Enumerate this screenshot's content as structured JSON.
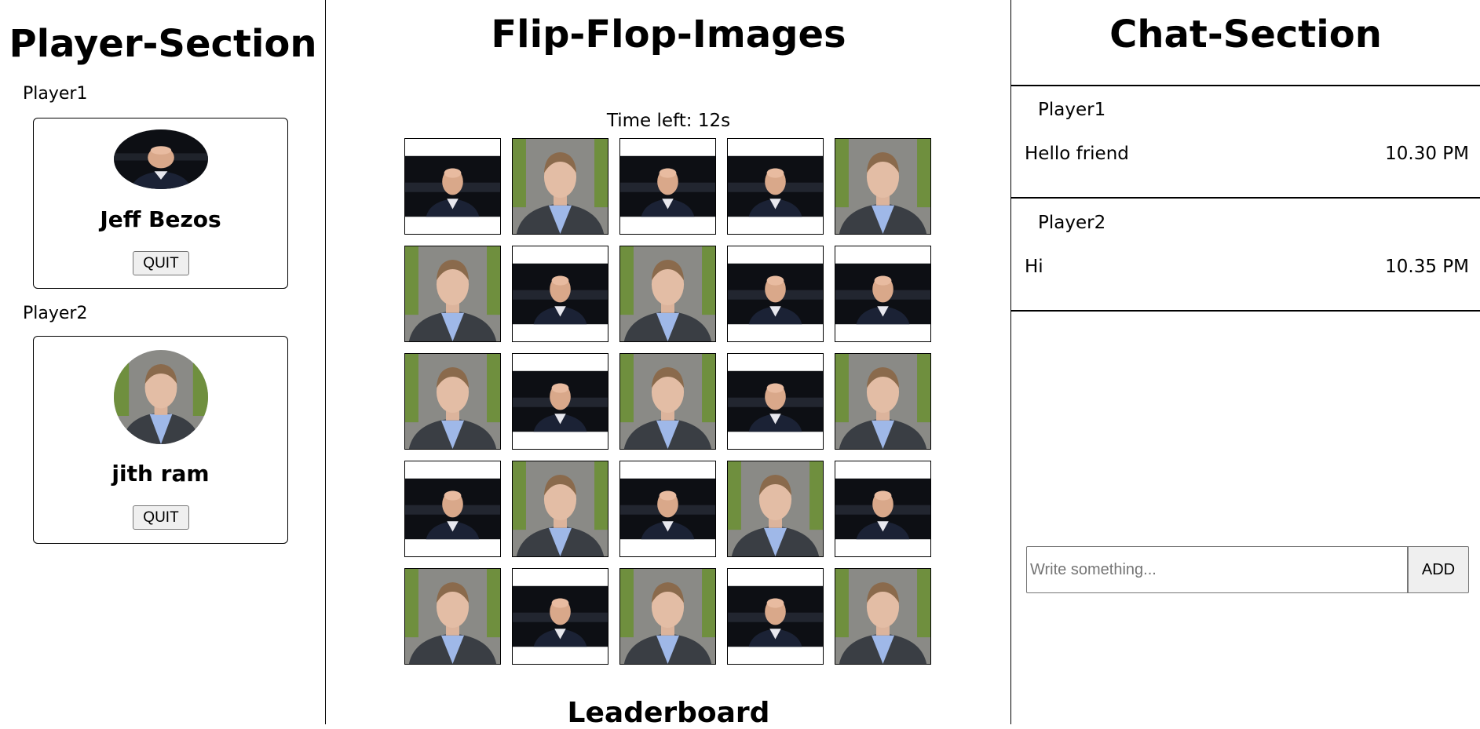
{
  "player_section": {
    "title": "Player-Section",
    "players": [
      {
        "label": "Player1",
        "name": "Jeff Bezos",
        "avatar": "bald-man-dark-bg",
        "quit_label": "QUIT"
      },
      {
        "label": "Player2",
        "name": "jith ram",
        "avatar": "young-man-outdoor",
        "quit_label": "QUIT"
      }
    ]
  },
  "game": {
    "title": "Flip-Flop-Images",
    "timer_text": "Time left: 12s",
    "grid": [
      [
        "bald-man-dark-bg",
        "young-man-outdoor",
        "bald-man-dark-bg",
        "bald-man-dark-bg",
        "young-man-outdoor"
      ],
      [
        "young-man-outdoor",
        "bald-man-dark-bg",
        "young-man-outdoor",
        "bald-man-dark-bg",
        "bald-man-dark-bg"
      ],
      [
        "young-man-outdoor",
        "bald-man-dark-bg",
        "young-man-outdoor",
        "bald-man-dark-bg",
        "young-man-outdoor"
      ],
      [
        "bald-man-dark-bg",
        "young-man-outdoor",
        "bald-man-dark-bg",
        "young-man-outdoor",
        "bald-man-dark-bg"
      ],
      [
        "young-man-outdoor",
        "bald-man-dark-bg",
        "young-man-outdoor",
        "bald-man-dark-bg",
        "young-man-outdoor"
      ]
    ],
    "leaderboard_title": "Leaderboard"
  },
  "chat": {
    "title": "Chat-Section",
    "messages": [
      {
        "sender": "Player1",
        "text": "Hello friend",
        "time": "10.30 PM"
      },
      {
        "sender": "Player2",
        "text": "Hi",
        "time": "10.35 PM"
      }
    ],
    "input_placeholder": "Write something...",
    "add_label": "ADD"
  }
}
